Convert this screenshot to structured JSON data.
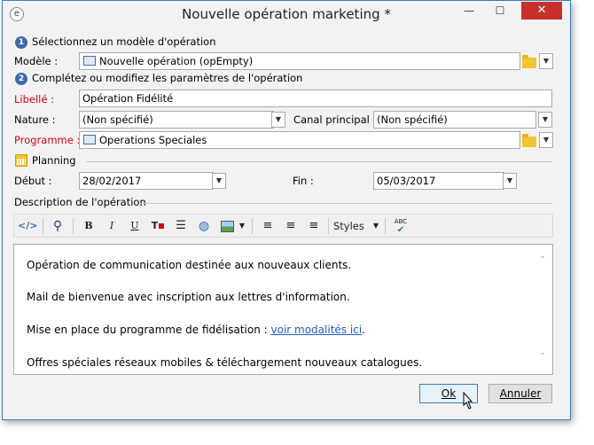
{
  "window": {
    "title": "Nouvelle opération marketing *",
    "minimize_glyph": "—",
    "maximize_glyph": "☐",
    "close_glyph": "✕"
  },
  "step1": {
    "number": "1",
    "label": "Sélectionnez un modèle d'opération"
  },
  "modele": {
    "label": "Modèle :",
    "value": "Nouvelle opération (opEmpty)"
  },
  "step2": {
    "number": "2",
    "label": "Complétez ou modifiez les paramètres de l'opération"
  },
  "libelle": {
    "label": "Libellé :",
    "value": "Opération Fidélité"
  },
  "nature": {
    "label": "Nature :",
    "value": "(Non spécifié)"
  },
  "canal": {
    "label": "Canal principal :",
    "value": "(Non spécifié)"
  },
  "programme": {
    "label": "Programme :",
    "value": "Operations Speciales"
  },
  "planning": {
    "label": "Planning",
    "debut_label": "Début :",
    "debut_value": "28/02/2017",
    "fin_label": "Fin :",
    "fin_value": "05/03/2017"
  },
  "description": {
    "label": "Description de l'opération",
    "toolbar": {
      "bold": "B",
      "italic": "I",
      "underline": "U",
      "styles_label": "Styles",
      "spell_label": "ABC"
    },
    "paragraphs": [
      "Opération de communication destinée aux nouveaux clients.",
      "Mail de bienvenue avec inscription aux lettres d'information.",
      "Mise en place du programme de fidélisation : ",
      "Offres spéciales réseaux mobiles & téléchargement nouveaux catalogues."
    ],
    "link_text": "voir modalités ici",
    "after_link": "."
  },
  "buttons": {
    "ok": "Ok",
    "cancel": "Annuler"
  },
  "colors": {
    "step_badge": "#3f6aa6",
    "required_label": "#d0021b",
    "link": "#1f5fbf",
    "close_button": "#c7302c"
  }
}
